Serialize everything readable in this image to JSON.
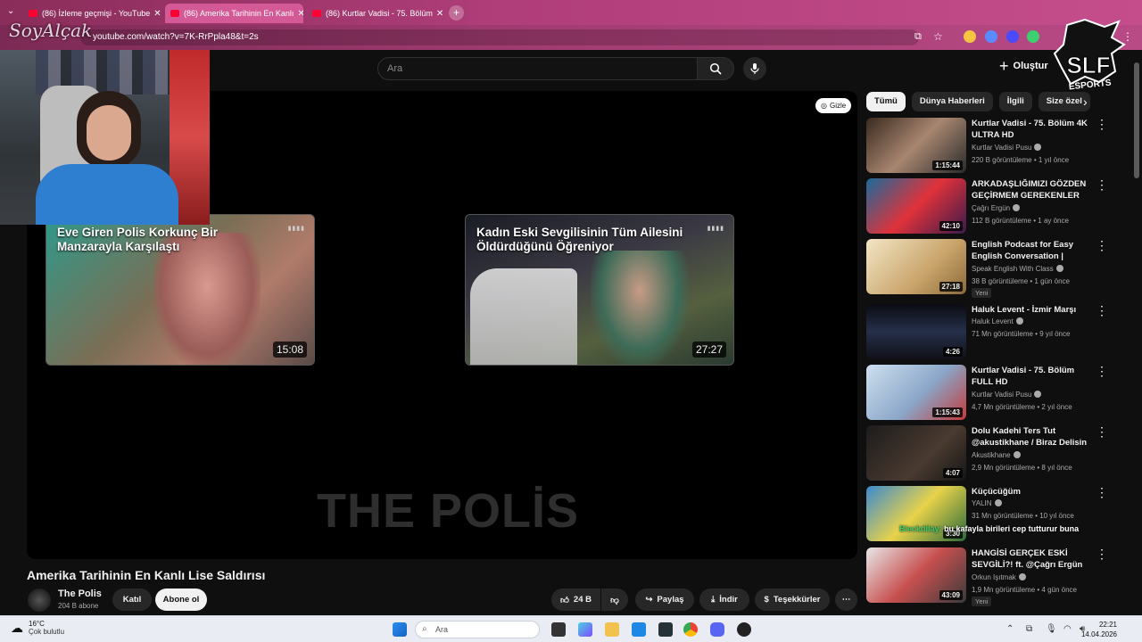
{
  "browser": {
    "tabs": [
      {
        "title": "(86) İzleme geçmişi - YouTube"
      },
      {
        "title": "(86) Amerika Tarihinin En Kanlı"
      },
      {
        "title": "(86) Kurtlar Vadisi - 75. Bölüm"
      }
    ],
    "url": "youtube.com/watch?v=7K-RrPpla48&t=2s",
    "overlay_logo_text": "SoyAlçak"
  },
  "youtube_header": {
    "search_placeholder": "Ara",
    "create_label": "Oluştur"
  },
  "brand_overlay": {
    "line1": "SLF",
    "line2": "ESPORTS"
  },
  "player": {
    "hide_button_label": "Gizle",
    "watermark": "THE POLİS",
    "end_cards": [
      {
        "title": "Eve Giren Polis Korkunç Bir Manzarayla Karşılaştı",
        "duration": "15:08"
      },
      {
        "title": "Kadın Eski Sevgilisinin Tüm Ailesini Öldürdüğünü Öğreniyor",
        "duration": "27:27"
      }
    ]
  },
  "video": {
    "title": "Amerika Tarihinin En Kanlı Lise Saldırısı",
    "channel_name": "The Polis",
    "subscribers": "204 B abone",
    "join_label": "Katıl",
    "subscribe_label": "Abone ol",
    "likes": "24 B",
    "share_label": "Paylaş",
    "download_label": "İndir",
    "thanks_label": "Teşekkürler"
  },
  "chips": [
    "Tümü",
    "Dünya Haberleri",
    "İlgili",
    "Size özel"
  ],
  "recommendations": [
    {
      "title": "Kurtlar Vadisi - 75. Bölüm 4K ULTRA HD",
      "channel": "Kurtlar Vadisi Pusu",
      "views": "220 B görüntüleme",
      "age": "1 yıl önce",
      "duration": "1:15:44",
      "badge": ""
    },
    {
      "title": "ARKADAŞLIĞIMIZI GÖZDEN GEÇİRMEM GEREKENLER VAR...",
      "channel": "Çağrı Ergün",
      "views": "112 B görüntüleme",
      "age": "1 ay önce",
      "duration": "42:10",
      "badge": ""
    },
    {
      "title": "English Podcast for Easy English Conversation | Healthy...",
      "channel": "Speak English With Class",
      "views": "38 B görüntüleme",
      "age": "1 gün önce",
      "duration": "27:18",
      "badge": "Yeni"
    },
    {
      "title": "Haluk Levent - İzmir Marşı",
      "channel": "Haluk Levent",
      "views": "71 Mn görüntüleme",
      "age": "9 yıl önce",
      "duration": "4:26",
      "badge": ""
    },
    {
      "title": "Kurtlar Vadisi - 75. Bölüm FULL HD",
      "channel": "Kurtlar Vadisi Pusu",
      "views": "4,7 Mn görüntüleme",
      "age": "2 yıl önce",
      "duration": "1:15:43",
      "badge": ""
    },
    {
      "title": "Dolu Kadehi Ters Tut @akustikhane / Biraz Delisin",
      "channel": "Akustikhane",
      "views": "2,9 Mn görüntüleme",
      "age": "8 yıl önce",
      "duration": "4:07",
      "badge": ""
    },
    {
      "title": "Küçücüğüm",
      "channel": "YALIN",
      "views": "31 Mn görüntüleme",
      "age": "10 yıl önce",
      "duration": "3:30",
      "badge": ""
    },
    {
      "title": "HANGİSİ GERÇEK ESKİ SEVGİLİ?! ft. @Çağrı Ergün",
      "channel": "Orkun Işıtmak",
      "views": "1,9 Mn görüntüleme",
      "age": "4 gün önce",
      "duration": "43:09",
      "badge": "Yeni"
    }
  ],
  "chat_overlay": {
    "user": "Bleckdilay:",
    "message": "bu kafayla birileri cep tutturur buna"
  },
  "taskbar": {
    "temperature": "16°C",
    "weather": "Çok bulutlu",
    "search_placeholder": "Ara",
    "time": "22:21",
    "date": "14.04.2026"
  }
}
